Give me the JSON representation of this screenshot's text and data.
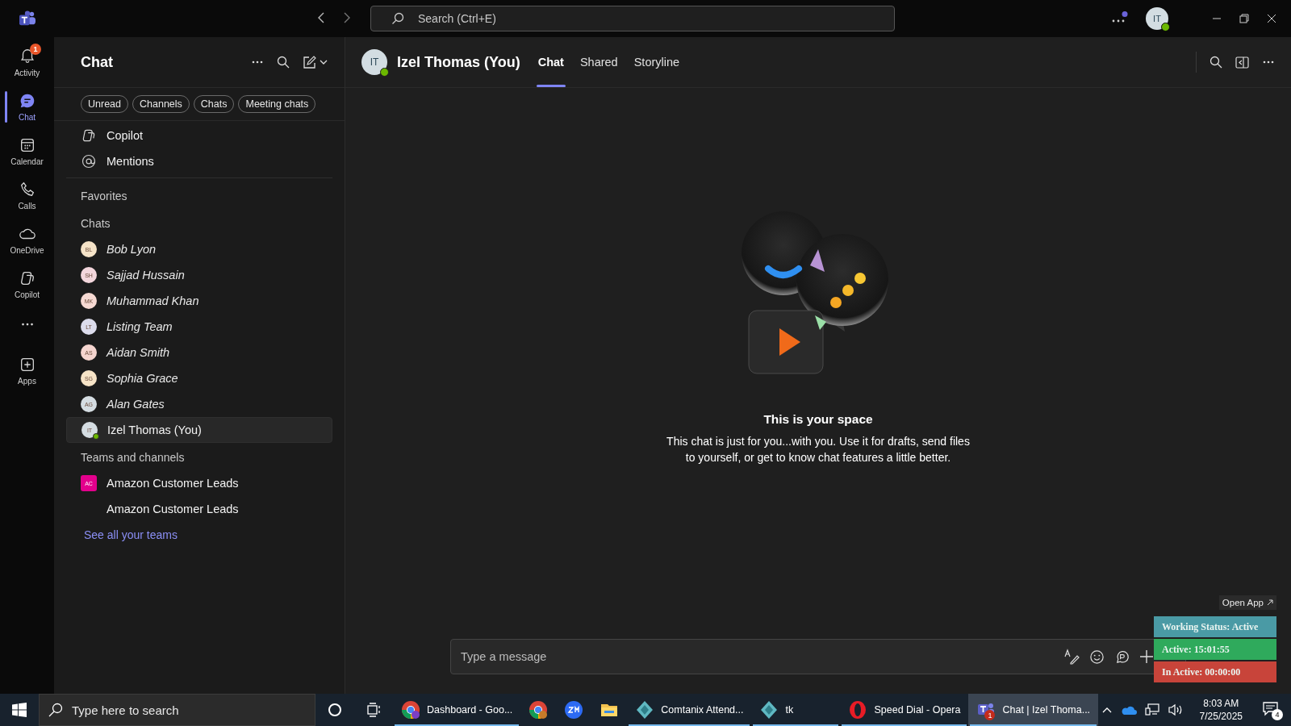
{
  "titlebar": {
    "search": {
      "placeholder": "Search (Ctrl+E)"
    },
    "avatar": {
      "initials": "IT",
      "online": true
    }
  },
  "rail": {
    "items": [
      {
        "kind": "activity",
        "label": "Activity",
        "selected": false,
        "badge": "1"
      },
      {
        "kind": "chat",
        "label": "Chat",
        "selected": true
      },
      {
        "kind": "calendar",
        "label": "Calendar",
        "selected": false
      },
      {
        "kind": "calls",
        "label": "Calls",
        "selected": false
      },
      {
        "kind": "onedrive",
        "label": "OneDrive",
        "selected": false
      },
      {
        "kind": "copilot",
        "label": "Copilot",
        "selected": false
      },
      {
        "kind": "more",
        "selected": false
      },
      {
        "kind": "apps",
        "label": "Apps",
        "selected": false
      }
    ]
  },
  "sidebar": {
    "title": "Chat",
    "filters": [
      {
        "label": "Unread",
        "selected": false
      },
      {
        "label": "Channels",
        "selected": false
      },
      {
        "label": "Chats",
        "selected": false
      },
      {
        "label": "Meeting chats",
        "selected": false
      }
    ],
    "pinned": [
      {
        "kind": "copilot",
        "label": "Copilot"
      },
      {
        "kind": "mentions",
        "label": "Mentions"
      }
    ],
    "favorites": {
      "title": "Favorites"
    },
    "chats": {
      "title": "Chats",
      "items": [
        {
          "initials": "BL",
          "name": "Bob Lyon",
          "color": "#f5e3c8",
          "no_messages": true,
          "selected": false
        },
        {
          "initials": "SH",
          "name": "Sajjad Hussain",
          "color": "#f3d6dc",
          "no_messages": true,
          "selected": false
        },
        {
          "initials": "MK",
          "name": "Muhammad Khan",
          "color": "#f6d9d2",
          "no_messages": true,
          "selected": false
        },
        {
          "initials": "LT",
          "name": "Listing Team",
          "color": "#dcdcec",
          "no_messages": true,
          "selected": false
        },
        {
          "initials": "AS",
          "name": "Aidan Smith",
          "color": "#f5d5cf",
          "no_messages": true,
          "selected": false
        },
        {
          "initials": "SG",
          "name": "Sophia Grace",
          "color": "#f7e4c7",
          "no_messages": true,
          "selected": false
        },
        {
          "initials": "AG",
          "name": "Alan Gates",
          "color": "#d5dde2",
          "no_messages": true,
          "selected": false
        },
        {
          "initials": "IT",
          "name": "Izel Thomas (You)",
          "color": "#d5dde2",
          "no_messages": false,
          "selected": true,
          "online": true
        }
      ]
    },
    "teams": {
      "title": "Teams and channels",
      "items": [
        {
          "kind": "team",
          "initials": "AC",
          "name": "Amazon Customer Leads",
          "color": "#e3008c"
        },
        {
          "kind": "channel",
          "name": "Amazon Customer Leads"
        }
      ]
    },
    "see_all": "See all your teams"
  },
  "conversation": {
    "avatar": {
      "initials": "IT",
      "online": true
    },
    "name": "Izel Thomas (You)",
    "tabs": [
      {
        "label": "Chat",
        "selected": true
      },
      {
        "label": "Shared",
        "selected": false
      },
      {
        "label": "Storyline",
        "selected": false
      }
    ],
    "empty_state": {
      "title": "This is your space",
      "body": "This chat is just for you...with you. Use it for drafts, send files to yourself, or get to know chat features a little better."
    },
    "composer": {
      "placeholder": "Type a message"
    }
  },
  "tracker": {
    "open_app": "Open App",
    "statuses": [
      {
        "label": "Working Status: Active",
        "color": "#4a9aa5"
      },
      {
        "label": "Active: 15:01:55",
        "color": "#2faa5c"
      },
      {
        "label": "In Active: 00:00:00",
        "color": "#c8443a"
      }
    ]
  },
  "taskbar": {
    "search": {
      "placeholder": "Type here to search"
    },
    "apps": [
      {
        "kind": "chrome",
        "label": "Dashboard - Goo...",
        "running": true,
        "selected": false,
        "color": "#7b3fc4"
      },
      {
        "kind": "chrome",
        "running": false,
        "selected": false,
        "color": "#c77b2a"
      },
      {
        "kind": "zoom",
        "running": false,
        "selected": false
      },
      {
        "kind": "explorer",
        "running": false,
        "selected": false
      },
      {
        "kind": "comtanix",
        "label": "Comtanix Attend...",
        "running": true,
        "selected": false
      },
      {
        "kind": "comtanix",
        "label": "tk",
        "running": true,
        "selected": false
      },
      {
        "kind": "opera",
        "label": "Speed Dial - Opera",
        "running": true,
        "selected": false
      },
      {
        "kind": "teams",
        "label": "Chat | Izel Thoma...",
        "running": true,
        "selected": true,
        "badge": "1"
      }
    ],
    "time": "8:03 AM",
    "date": "7/25/2025",
    "notifications": "4"
  }
}
